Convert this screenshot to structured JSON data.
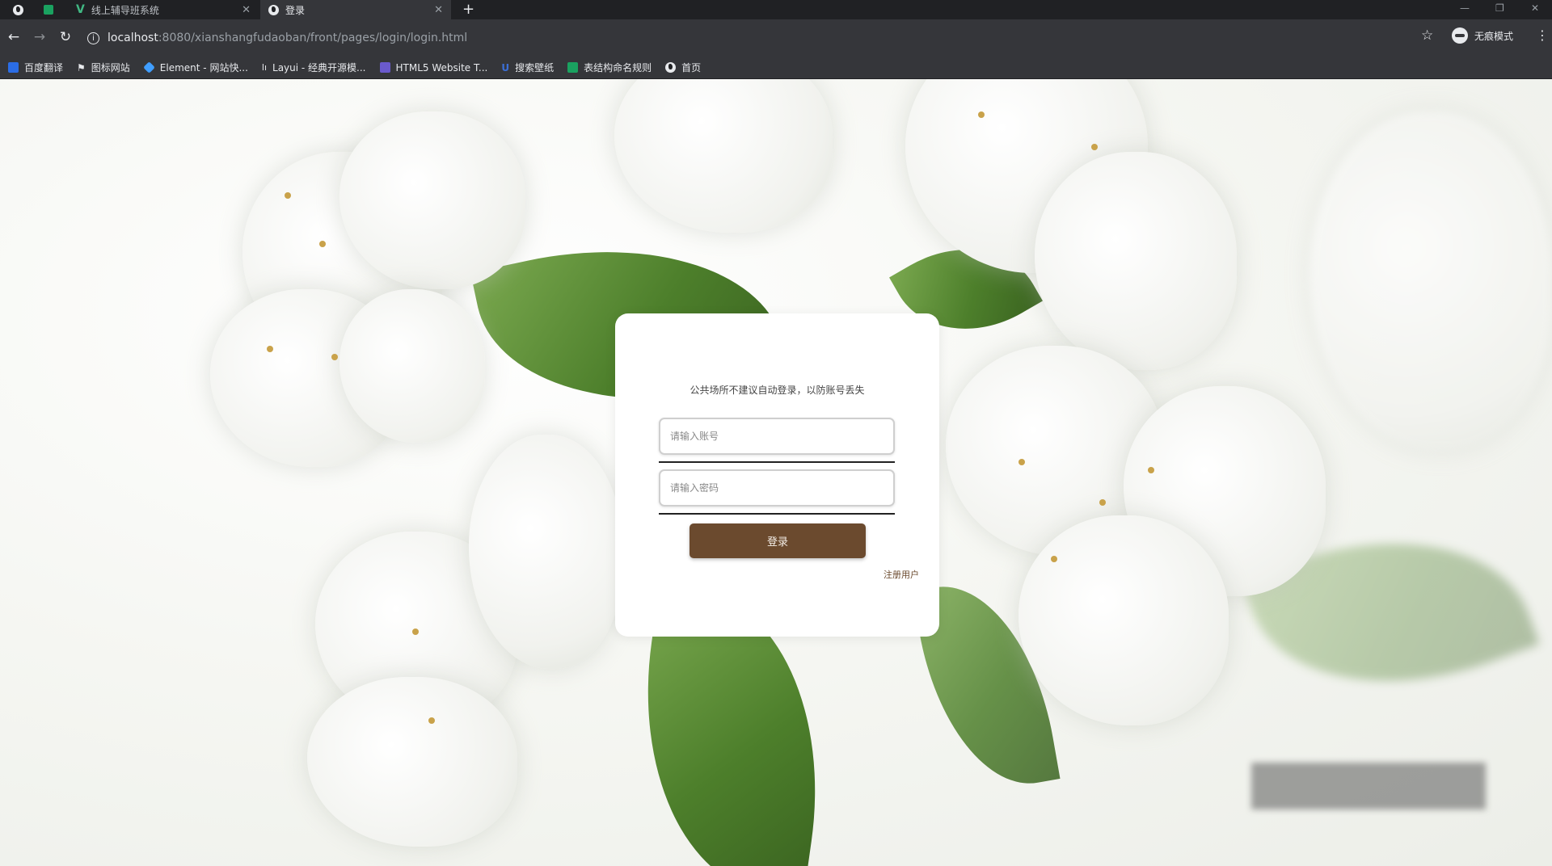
{
  "browser": {
    "tabs": [
      {
        "title": "",
        "favicon": "globe-icon"
      },
      {
        "title": "",
        "favicon": "sheet-icon"
      },
      {
        "title": "线上辅导班系统",
        "favicon": "vue-icon"
      },
      {
        "title": "登录",
        "favicon": "globe-icon"
      }
    ],
    "url": {
      "host": "localhost",
      "rest": ":8080/xianshangfudaoban/front/pages/login/login.html"
    },
    "profile_label": "无痕模式",
    "bookmarks": [
      {
        "label": "百度翻译",
        "color": "#2b6de5"
      },
      {
        "label": "图标网站",
        "color": "#e8eaed"
      },
      {
        "label": "Element - 网站快...",
        "color": "#409eff"
      },
      {
        "label": "Layui - 经典开源模...",
        "color": "#e8eaed"
      },
      {
        "label": "HTML5 Website T...",
        "color": "#6a5acd"
      },
      {
        "label": "搜索壁纸",
        "color": "#3b6fd6"
      },
      {
        "label": "表结构命名规则",
        "color": "#1aa260"
      },
      {
        "label": "首页",
        "color": "#e8eaed"
      }
    ]
  },
  "login": {
    "tip": "公共场所不建议自动登录，以防账号丢失",
    "account_placeholder": "请输入账号",
    "password_placeholder": "请输入密码",
    "submit_label": "登录",
    "register_label": "注册用户"
  },
  "theme": {
    "button_color": "#6b4a2e"
  }
}
